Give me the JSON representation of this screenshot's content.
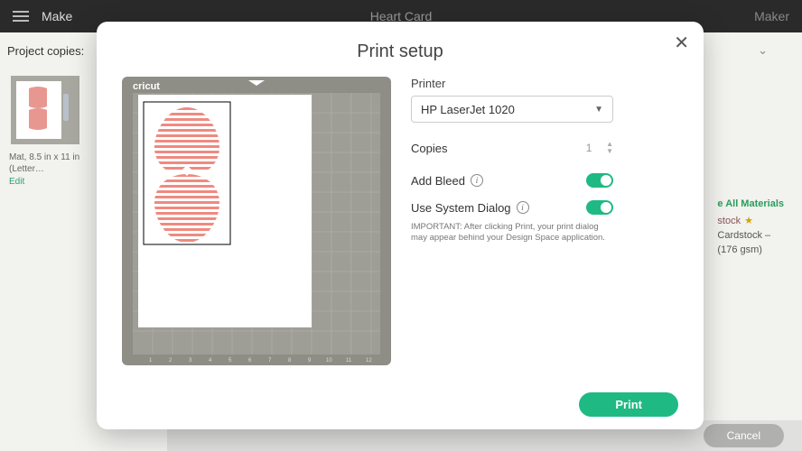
{
  "topbar": {
    "make": "Make",
    "title": "Heart Card",
    "maker": "Maker"
  },
  "subbar": {
    "label": "Project copies:"
  },
  "mat": {
    "caption": "Mat, 8.5 in x 11 in (Letter…",
    "edit": "Edit"
  },
  "right": {
    "all_materials": "e All Materials",
    "stock": "stock",
    "card1": "Cardstock –",
    "card2": "(176 gsm)"
  },
  "footer": {
    "cancel": "Cancel"
  },
  "modal": {
    "title": "Print setup",
    "printer_label": "Printer",
    "printer_value": "HP LaserJet 1020",
    "copies_label": "Copies",
    "copies_value": "1",
    "bleed_label": "Add Bleed",
    "sysdialog_label": "Use System Dialog",
    "important": "IMPORTANT: After clicking Print, your print dialog may appear behind your Design Space application.",
    "print": "Print",
    "preview_brand": "cricut"
  }
}
